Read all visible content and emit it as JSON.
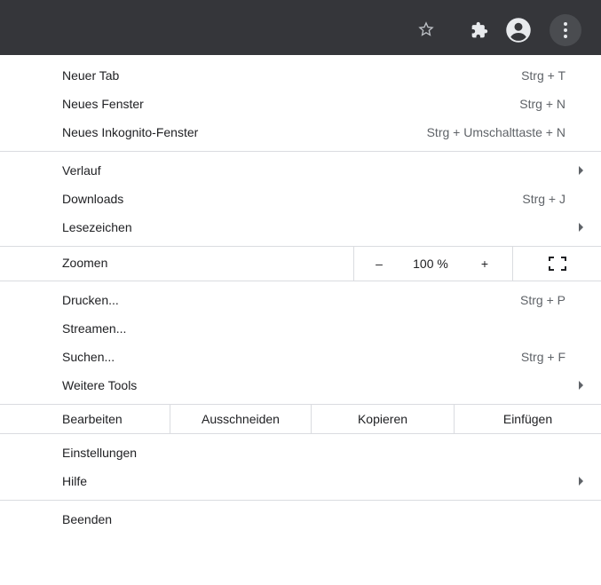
{
  "toolbar": {
    "icons": [
      "star-icon",
      "extensions-puzzle-icon",
      "profile-avatar-icon",
      "more-vert-icon"
    ],
    "bg_color": "#35363a"
  },
  "menu": {
    "group1": [
      {
        "label": "Neuer Tab",
        "shortcut": "Strg + T"
      },
      {
        "label": "Neues Fenster",
        "shortcut": "Strg + N"
      },
      {
        "label": "Neues Inkognito-Fenster",
        "shortcut": "Strg + Umschalttaste + N"
      }
    ],
    "group2": [
      {
        "label": "Verlauf",
        "shortcut": ""
      },
      {
        "label": "Downloads",
        "shortcut": "Strg + J"
      },
      {
        "label": "Lesezeichen",
        "shortcut": ""
      }
    ],
    "zoom": {
      "label": "Zoomen",
      "minus": "–",
      "value": "100 %",
      "plus": "+"
    },
    "group3": [
      {
        "label": "Drucken...",
        "shortcut": "Strg + P"
      },
      {
        "label": "Streamen...",
        "shortcut": ""
      },
      {
        "label": "Suchen...",
        "shortcut": "Strg + F"
      },
      {
        "label": "Weitere Tools",
        "shortcut": ""
      }
    ],
    "edit": {
      "label": "Bearbeiten",
      "cut": "Ausschneiden",
      "copy": "Kopieren",
      "paste": "Einfügen"
    },
    "group4": [
      {
        "label": "Einstellungen"
      },
      {
        "label": "Hilfe"
      }
    ],
    "exit": {
      "label": "Beenden"
    }
  }
}
